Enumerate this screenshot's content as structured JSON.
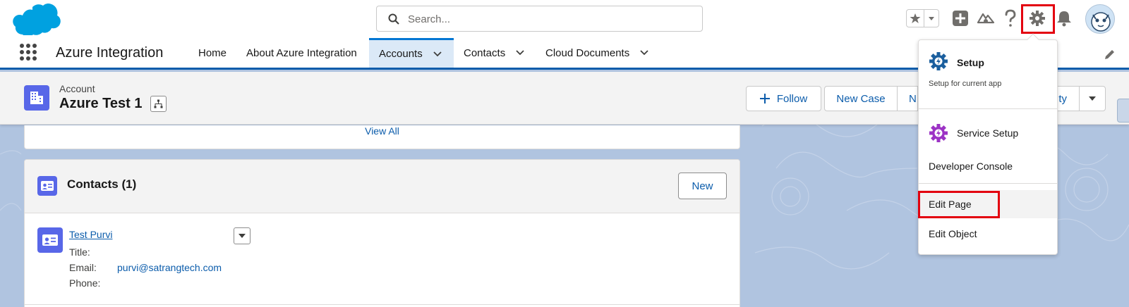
{
  "global_header": {
    "search_placeholder": "Search...",
    "icons": [
      "salesforce-cloud-logo",
      "search-icon",
      "star-icon",
      "chevron-down-icon",
      "plus-icon",
      "trailhead-icon",
      "help-icon",
      "setup-gear-icon",
      "bell-icon",
      "user-avatar"
    ]
  },
  "nav": {
    "app_name": "Azure Integration",
    "items": [
      {
        "label": "Home",
        "has_menu": false,
        "active": false
      },
      {
        "label": "About Azure Integration",
        "has_menu": false,
        "active": false
      },
      {
        "label": "Accounts",
        "has_menu": true,
        "active": true
      },
      {
        "label": "Contacts",
        "has_menu": true,
        "active": false
      },
      {
        "label": "Cloud Documents",
        "has_menu": true,
        "active": false
      }
    ]
  },
  "record": {
    "type": "Account",
    "title": "Azure Test 1",
    "actions": {
      "follow": "Follow",
      "new_case": "New Case",
      "partial_left": "N",
      "partial_right": "ty"
    }
  },
  "main": {
    "view_all": "View All",
    "contacts_card": {
      "title": "Contacts (1)",
      "new_button": "New",
      "contact": {
        "name": "Test Purvi",
        "title_label": "Title:",
        "title_value": "",
        "email_label": "Email:",
        "email_value": "purvi@satrangtech.com",
        "phone_label": "Phone:",
        "phone_value": ""
      }
    }
  },
  "setup_menu": {
    "setup_title": "Setup",
    "setup_subtitle": "Setup for current app",
    "service_setup": "Service Setup",
    "developer_console": "Developer Console",
    "edit_page": "Edit Page",
    "edit_object": "Edit Object"
  },
  "colors": {
    "brand_blue": "#0176d3",
    "link_blue": "#0b5cab",
    "account_icon": "#5867e8",
    "setup_gear": "#1b5f9e",
    "service_gear": "#9c33c5",
    "highlight_red": "#e3000f"
  }
}
